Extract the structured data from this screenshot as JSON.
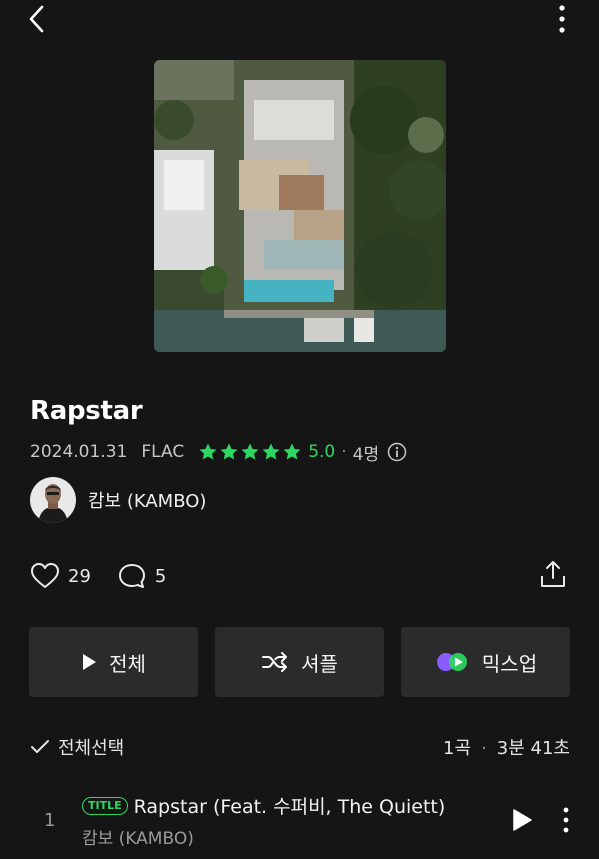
{
  "header": {
    "back_icon": "chevron-left-icon",
    "more_icon": "more-vertical-icon"
  },
  "album": {
    "title": "Rapstar",
    "release_date": "2024.01.31",
    "format": "FLAC",
    "rating": "5.0",
    "rating_stars": 5,
    "rating_count": "4명",
    "accent_color": "#2cd862"
  },
  "artist": {
    "name": "캄보 (KAMBO)"
  },
  "social": {
    "likes": "29",
    "comments": "5"
  },
  "actions": {
    "play_all": "전체",
    "shuffle": "셔플",
    "mixup": "믹스업"
  },
  "selection": {
    "select_all": "전체선택",
    "track_count": "1곡",
    "duration": "3분 41초"
  },
  "tracks": [
    {
      "number": "1",
      "badge": "TITLE",
      "title": "Rapstar (Feat. 수퍼비, The Quiett)",
      "artist": "캄보 (KAMBO)"
    }
  ]
}
